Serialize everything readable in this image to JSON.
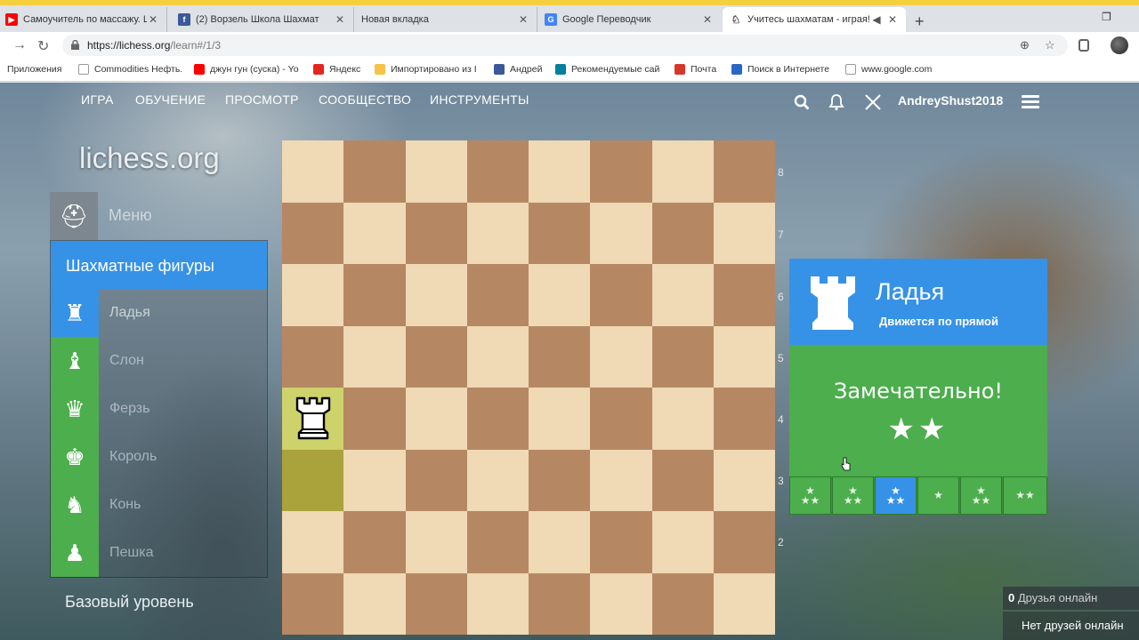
{
  "browser": {
    "tabs": [
      {
        "title": "Самоучитель по массажу. ШВЗ",
        "favicon": "youtube-icon",
        "color": "#ff0000"
      },
      {
        "title": "(2) Ворзель Школа Шахмат",
        "favicon": "facebook-icon",
        "color": "#3b5998"
      },
      {
        "title": "Новая вкладка",
        "favicon": "",
        "color": ""
      },
      {
        "title": "Google Переводчик",
        "favicon": "google-translate-icon",
        "color": "#4285f4"
      },
      {
        "title": "Учитесь шахматам - играя!",
        "favicon": "lichess-icon",
        "color": "#555555",
        "active": true
      }
    ],
    "url_main": "https://lichess.org",
    "url_path": "/learn#/1/3",
    "bookmarks": [
      {
        "label": "Приложения",
        "icon": "apps-icon",
        "color": "#4285f4"
      },
      {
        "label": "Commodities Нефть.",
        "icon": "page-icon",
        "color": "#cccccc"
      },
      {
        "label": "джун гун (суска) - Yo",
        "icon": "youtube-icon",
        "color": "#ff0000"
      },
      {
        "label": "Яндекс",
        "icon": "yandex-icon",
        "color": "#e52620"
      },
      {
        "label": "Импортировано из I",
        "icon": "folder-icon",
        "color": "#f6c445"
      },
      {
        "label": "Андрей",
        "icon": "facebook-icon",
        "color": "#3b5998"
      },
      {
        "label": "Рекомендуемые сай",
        "icon": "bing-icon",
        "color": "#00809d"
      },
      {
        "label": "Почта",
        "icon": "mail-icon",
        "color": "#d9362b"
      },
      {
        "label": "Поиск в Интернете",
        "icon": "search-icon",
        "color": "#2b66c4"
      },
      {
        "label": "www.google.com",
        "icon": "page-icon",
        "color": "#cccccc"
      }
    ]
  },
  "site": {
    "nav": [
      "ИГРА",
      "ОБУЧЕНИЕ",
      "ПРОСМОТР",
      "СООБЩЕСТВО",
      "ИНСТРУМЕНТЫ"
    ],
    "username": "AndreyShust2018",
    "logo": "lichess.org"
  },
  "sidebar": {
    "menu_label": "Меню",
    "category": "Шахматные фигуры",
    "lessons": [
      {
        "label": "Ладья",
        "icon": "rook-icon",
        "glyph": "♜",
        "active": true
      },
      {
        "label": "Слон",
        "icon": "bishop-icon",
        "glyph": "♝"
      },
      {
        "label": "Ферзь",
        "icon": "queen-icon",
        "glyph": "♛"
      },
      {
        "label": "Король",
        "icon": "king-icon",
        "glyph": "♚"
      },
      {
        "label": "Конь",
        "icon": "knight-icon",
        "glyph": "♞"
      },
      {
        "label": "Пешка",
        "icon": "pawn-icon",
        "glyph": "♟"
      }
    ],
    "next_section": "Базовый уровень"
  },
  "board": {
    "ranks": [
      "8",
      "7",
      "6",
      "5",
      "4",
      "3",
      "2"
    ],
    "pieces": [
      {
        "square": "a4",
        "piece": "white-rook"
      }
    ],
    "highlights": [
      {
        "square": "a4",
        "color": "#cdd26a"
      },
      {
        "square": "a3",
        "color": "#aaa23a"
      }
    ]
  },
  "lesson_panel": {
    "title": "Ладья",
    "subtitle": "Движется по прямой",
    "message": "Замечательно!",
    "stars_earned": 2,
    "stars_glyph": "★★",
    "levels": [
      {
        "stars": "★\n★★"
      },
      {
        "stars": "★\n★★"
      },
      {
        "stars": "★\n★★",
        "current": true
      },
      {
        "stars": "★"
      },
      {
        "stars": "★\n★★"
      },
      {
        "stars": "★★"
      }
    ],
    "colors": {
      "blue": "#3692e7",
      "green": "#4cae4c"
    }
  },
  "friends": {
    "count": "0",
    "online_label": "Друзья онлайн",
    "none_label": "Нет друзей онлайн"
  }
}
